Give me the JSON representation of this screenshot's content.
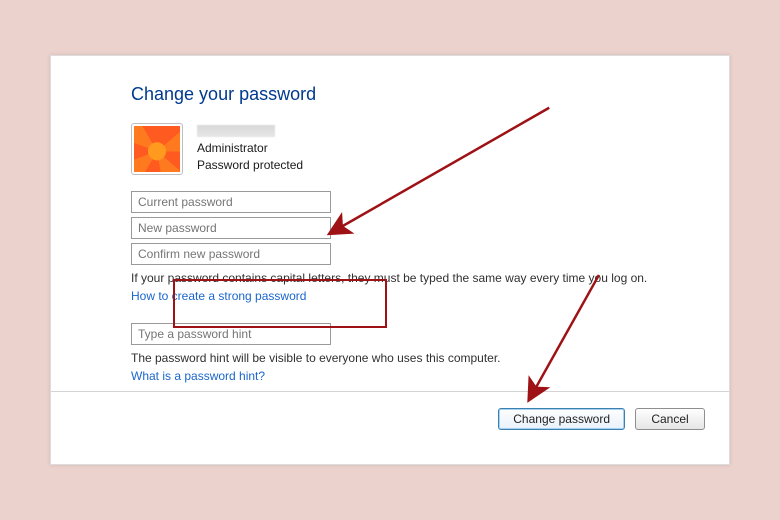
{
  "title": "Change your password",
  "account": {
    "role": "Administrator",
    "status": "Password protected"
  },
  "fields": {
    "current_placeholder": "Current password",
    "new_placeholder": "New password",
    "confirm_placeholder": "Confirm new password",
    "hint_placeholder": "Type a password hint"
  },
  "notes": {
    "caps": "If your password contains capital letters, they must be typed the same way every time you log on.",
    "hint_visibility": "The password hint will be visible to everyone who uses this computer."
  },
  "links": {
    "strong_pw": "How to create a strong password",
    "hint_help": "What is a password hint?"
  },
  "buttons": {
    "change": "Change password",
    "cancel": "Cancel"
  },
  "colors": {
    "page_bg": "#ecd2cd",
    "title": "#003a8f",
    "link": "#1a66cc",
    "annotation": "#9e1115"
  }
}
